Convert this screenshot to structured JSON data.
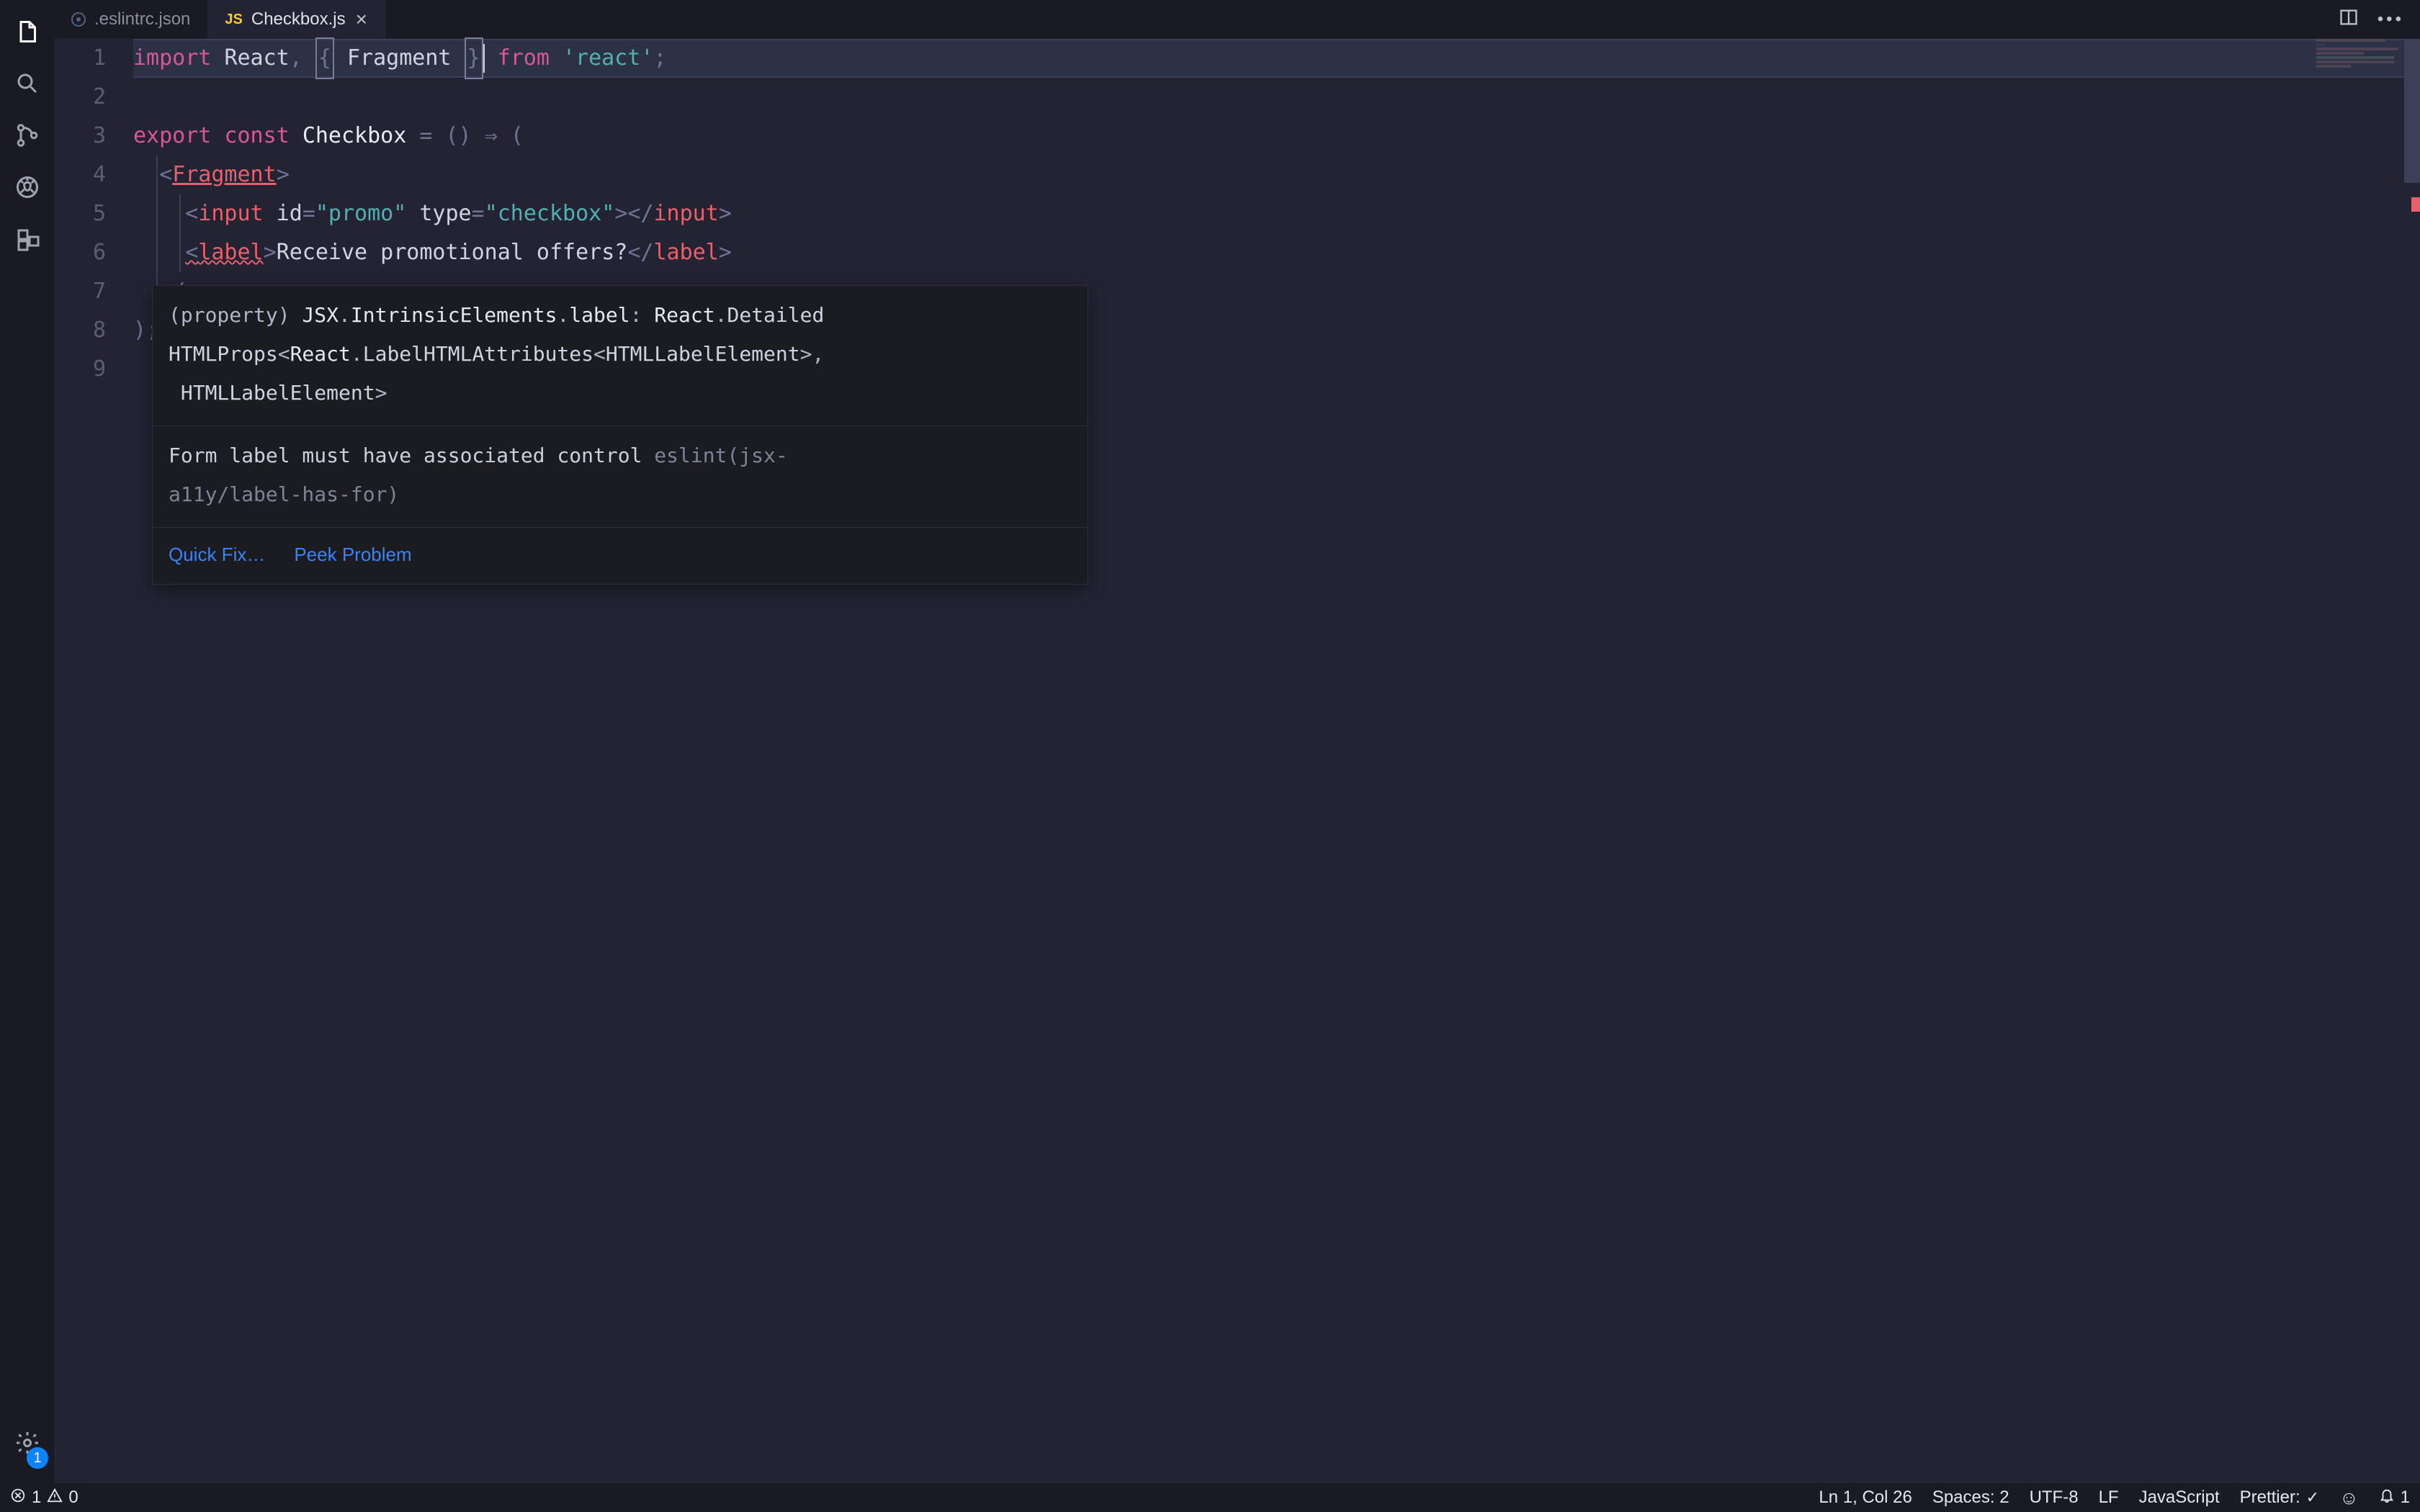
{
  "tabs": {
    "inactive": {
      "label": ".eslintrc.json"
    },
    "active": {
      "label": "Checkbox.js",
      "icon_label": "JS"
    }
  },
  "gutter": {
    "lines": [
      "1",
      "2",
      "3",
      "4",
      "5",
      "6",
      "7",
      "8",
      "9"
    ]
  },
  "code": {
    "l1": {
      "import": "import",
      "react": "React",
      "comma": ",",
      "lb": "{",
      "fragment": "Fragment",
      "rb": "}",
      "from": "from",
      "module": "'react'",
      "semi": ";"
    },
    "l3": {
      "export": "export",
      "const": "const",
      "name": "Checkbox",
      "eq": "=",
      "parens": "()",
      "arrow": "⇒",
      "open": "("
    },
    "l4": {
      "open": "<",
      "tag": "Fragment",
      "close": ">"
    },
    "l5": {
      "open": "<",
      "tag": "input",
      "idattr": "id",
      "eq1": "=",
      "idval": "\"promo\"",
      "typeattr": "type",
      "eq2": "=",
      "typeval": "\"checkbox\"",
      "close1": ">",
      "open2": "</",
      "tag2": "input",
      "close2": ">"
    },
    "l6": {
      "open": "<",
      "tag": "label",
      "close1": ">",
      "text": "Receive promotional offers?",
      "open2": "</",
      "tag2": "label",
      "close2": ">"
    },
    "l7": {
      "open": "</"
    },
    "l8": {
      "close": ");"
    }
  },
  "hover": {
    "type_line1a": "(property) ",
    "type_line1b": "JSX",
    "type_line1c": ".",
    "type_line1d": "IntrinsicElements",
    "type_line1e": ".",
    "type_line1f": "label",
    "type_line1g": ": ",
    "type_line1h": "React",
    "type_line1i": ".",
    "type_line1j": "Detailed",
    "type_line2a": "HTMLProps",
    "type_line2b": "<",
    "type_line2c": "React",
    "type_line2d": ".",
    "type_line2e": "LabelHTMLAttributes",
    "type_line2f": "<",
    "type_line2g": "HTMLLabelElement",
    "type_line2h": ">",
    "type_line2i": ",",
    "type_line3a": " HTMLLabelElement",
    "type_line3b": ">",
    "lint_msg": "Form label must have associated control ",
    "lint_rule1": "eslint(jsx-",
    "lint_rule2": "a11y/label-has-for)",
    "quick_fix": "Quick Fix…",
    "peek": "Peek Problem"
  },
  "statusbar": {
    "errors": "1",
    "warnings": "0",
    "cursor": "Ln 1, Col 26",
    "spaces": "Spaces: 2",
    "encoding": "UTF-8",
    "eol": "LF",
    "lang": "JavaScript",
    "prettier": "Prettier:",
    "bell": "1"
  },
  "activity": {
    "gear_badge": "1"
  }
}
